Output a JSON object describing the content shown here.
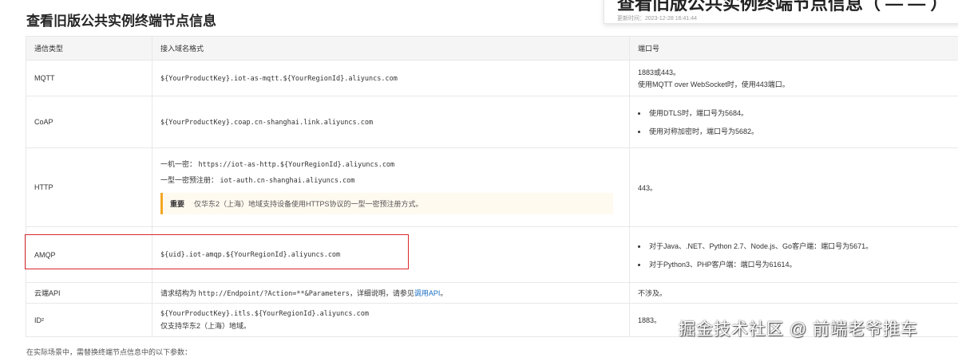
{
  "page_title": "查看旧版公共实例终端节点信息",
  "float_card": {
    "title": "查看旧版公共实例终端节点信息（ — — ）",
    "meta": "更新时间：2023-12-28 16:41:44"
  },
  "table": {
    "headers": [
      "通信类型",
      "接入域名格式",
      "端口号"
    ],
    "rows": {
      "mqtt": {
        "type": "MQTT",
        "domain": "${YourProductKey}.iot-as-mqtt.${YourRegionId}.aliyuncs.com",
        "port_line1": "1883或443。",
        "port_line2": "使用MQTT over WebSocket时，使用443端口。"
      },
      "coap": {
        "type": "CoAP",
        "domain": "${YourProductKey}.coap.cn-shanghai.link.aliyuncs.com",
        "port_items": [
          "使用DTLS时，端口号为5684。",
          "使用对称加密时，端口号为5682。"
        ]
      },
      "http": {
        "type": "HTTP",
        "line1_label": "一机一密：",
        "line1_value": "https://iot-as-http.${YourRegionId}.aliyuncs.com",
        "line2_label": "一型一密预注册：",
        "line2_value": "iot-auth.cn-shanghai.aliyuncs.com",
        "notice_label": "重要",
        "notice_text": "仅华东2（上海）地域支持设备使用HTTPS协议的一型一密预注册方式。",
        "port": "443。"
      },
      "amqp": {
        "type": "AMQP",
        "domain": "${uid}.iot-amqp.${YourRegionId}.aliyuncs.com",
        "port_items": [
          "对于Java、.NET、Python 2.7、Node.js、Go客户端：端口号为5671。",
          "对于Python3、PHP客户端：端口号为61614。"
        ]
      },
      "cloud_api": {
        "type": "云端API",
        "desc_prefix": "请求结构为",
        "desc_code": "http://Endpoint/?Action=**&Parameters",
        "desc_mid": "，详细说明，请参见",
        "desc_link": "调用API",
        "desc_suffix": "。",
        "port": "不涉及。"
      },
      "id2": {
        "type": "ID²",
        "domain": "${YourProductKey}.itls.${YourRegionId}.aliyuncs.com",
        "note": "仅支持华东2（上海）地域。",
        "port": "1883。"
      }
    }
  },
  "footer_text": "在实际场景中，需替换终端节点信息中的以下参数：",
  "watermark": "掘金技术社区 @ 前端老爷推车",
  "colors": {
    "highlight_border": "#d9292b",
    "link": "#1a6fc2",
    "notice_border": "#f5a623"
  }
}
